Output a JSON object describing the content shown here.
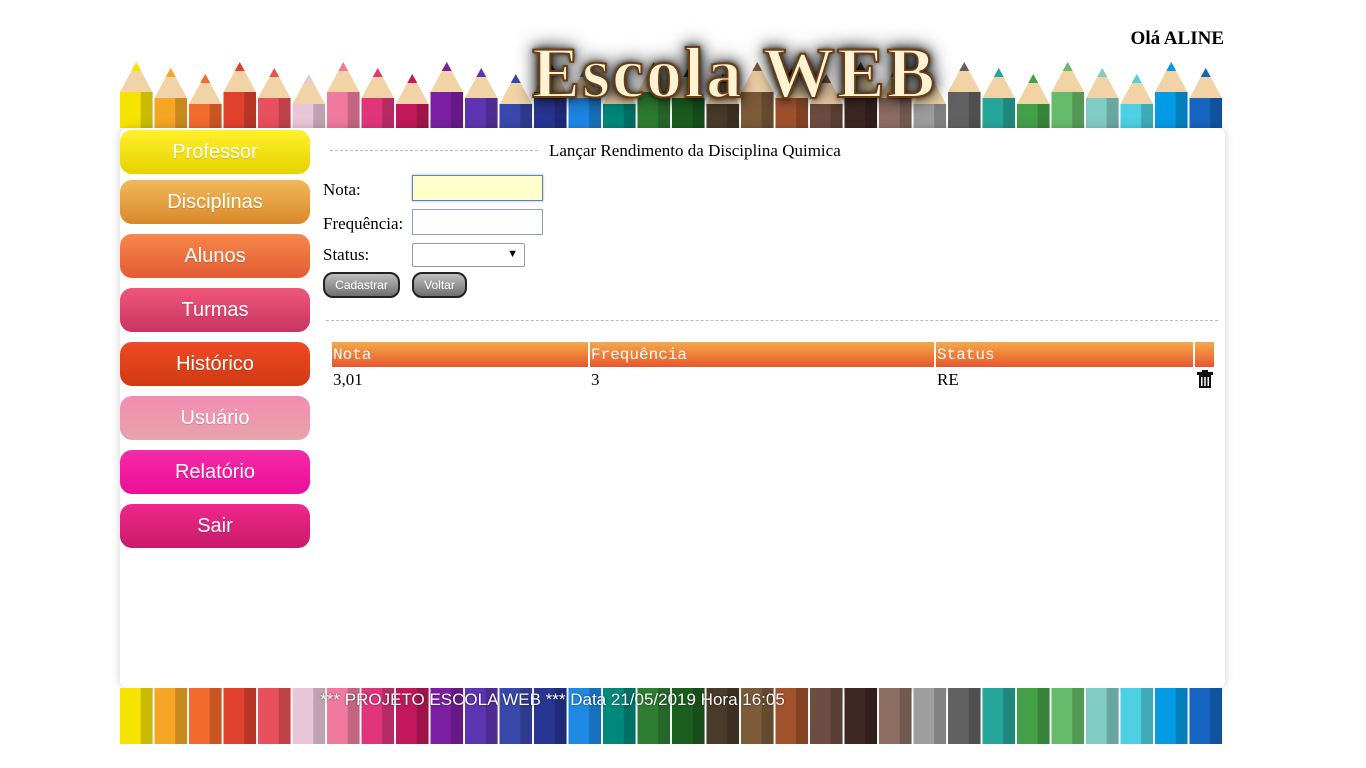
{
  "header": {
    "logo_text": "Escola WEB",
    "greeting": "Olá ALINE"
  },
  "menu": {
    "items": [
      {
        "label": "Professor",
        "color_top": "#fff12c",
        "color_bottom": "#e6d200"
      },
      {
        "label": "Disciplinas",
        "color_top": "#f3b85a",
        "color_bottom": "#d9892a"
      },
      {
        "label": "Alunos",
        "color_top": "#f7884a",
        "color_bottom": "#e35c34"
      },
      {
        "label": "Turmas",
        "color_top": "#f0567a",
        "color_bottom": "#c73563"
      },
      {
        "label": "Histórico",
        "color_top": "#ee4a24",
        "color_bottom": "#cf3a12"
      },
      {
        "label": "Usuário",
        "color_top": "#f38cb1",
        "color_bottom": "#e8a3ab"
      },
      {
        "label": "Relatório",
        "color_top": "#f72aa6",
        "color_bottom": "#ea0f99"
      },
      {
        "label": "Sair",
        "color_top": "#f0288a",
        "color_bottom": "#c81a6c"
      }
    ]
  },
  "form": {
    "legend": "Lançar Rendimento da Disciplina Quimica",
    "nota_label": "Nota:",
    "nota_value": "",
    "frequencia_label": "Frequência:",
    "frequencia_value": "",
    "status_label": "Status:",
    "status_selected": "",
    "cadastrar_label": "Cadastrar",
    "voltar_label": "Voltar"
  },
  "table": {
    "headers": [
      "Nota",
      "Frequência",
      "Status",
      ""
    ],
    "rows": [
      {
        "nota": "3,01",
        "frequencia": "3",
        "status": "RE",
        "action_icon": "trash-icon"
      }
    ]
  },
  "footer": {
    "text": "*** PROJETO ESCOLA WEB *** Data 21/05/2019 Hora 16:05"
  }
}
